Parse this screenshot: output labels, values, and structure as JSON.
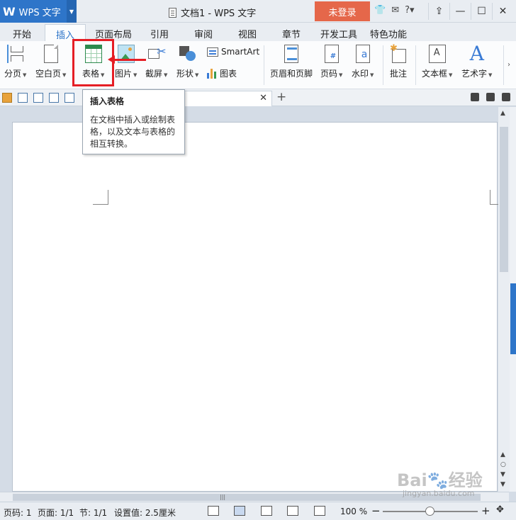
{
  "app": {
    "name": "WPS 文字",
    "logo": "W"
  },
  "window": {
    "title": "文档1 - WPS 文字",
    "login_label": "未登录"
  },
  "tabs": [
    {
      "label": "开始"
    },
    {
      "label": "插入"
    },
    {
      "label": "页面布局"
    },
    {
      "label": "引用"
    },
    {
      "label": "审阅"
    },
    {
      "label": "视图"
    },
    {
      "label": "章节"
    },
    {
      "label": "开发工具"
    },
    {
      "label": "特色功能"
    }
  ],
  "active_tab": "插入",
  "ribbon": {
    "page_break": "分页",
    "blank_page": "空白页",
    "table": "表格",
    "picture": "图片",
    "screenshot": "截屏",
    "shape": "形状",
    "smartart": "SmartArt",
    "chart": "图表",
    "header_footer": "页眉和页脚",
    "page_number": "页码",
    "watermark": "水印",
    "comment": "批注",
    "textbox": "文本框",
    "wordart": "艺术字"
  },
  "tooltip": {
    "title": "插入表格",
    "body": "在文档中插入或绘制表格，以及文本与表格的相互转换。"
  },
  "status": {
    "page_label": "页码: 1",
    "pages": "页面: 1/1",
    "section": "节: 1/1",
    "setting": "设置值: 2.5厘米",
    "zoom": "100 %"
  },
  "watermark": {
    "brand": "Bai🐾经验",
    "url": "jingyan.baidu.com"
  },
  "colors": {
    "accent": "#2e75c9",
    "login": "#e5674a",
    "highlight": "#e51e25"
  }
}
